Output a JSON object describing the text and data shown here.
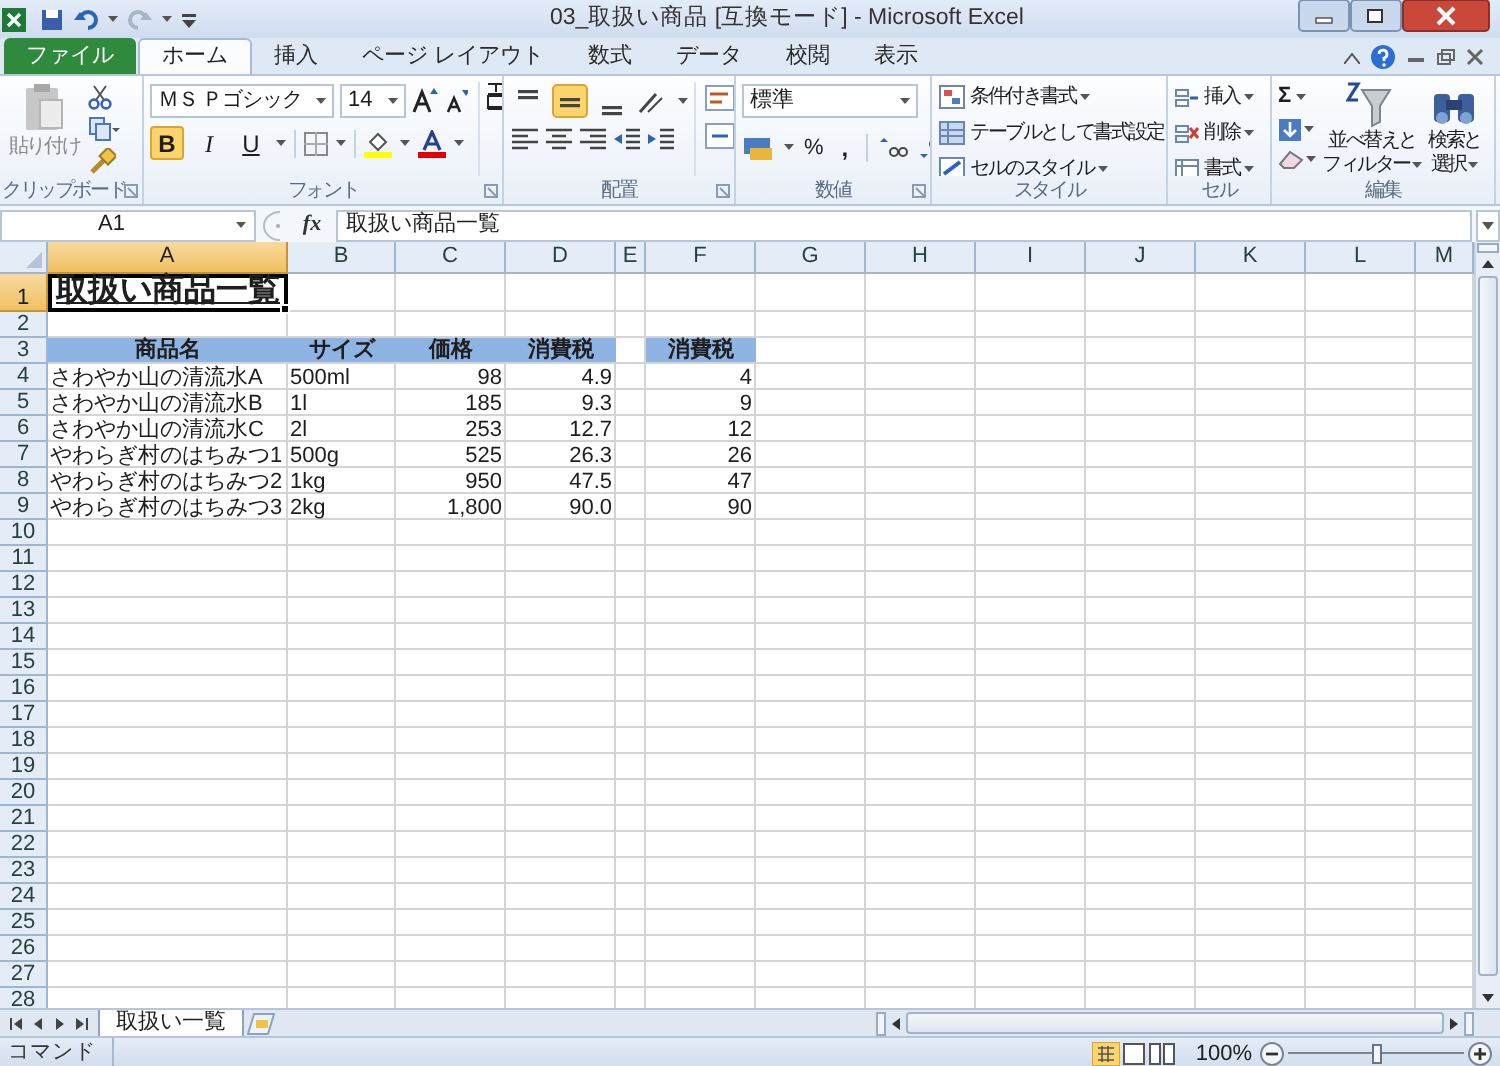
{
  "window": {
    "title": "03_取扱い商品 [互換モード] - Microsoft Excel"
  },
  "ribbon_tabs": [
    {
      "label": "ファイル",
      "kind": "file",
      "selected": false
    },
    {
      "label": "ホーム",
      "kind": "tab",
      "selected": true
    },
    {
      "label": "挿入",
      "kind": "tab",
      "selected": false
    },
    {
      "label": "ページ レイアウト",
      "kind": "tab",
      "selected": false
    },
    {
      "label": "数式",
      "kind": "tab",
      "selected": false
    },
    {
      "label": "データ",
      "kind": "tab",
      "selected": false
    },
    {
      "label": "校閲",
      "kind": "tab",
      "selected": false
    },
    {
      "label": "表示",
      "kind": "tab",
      "selected": false
    }
  ],
  "clipboard": {
    "paste": "貼り付け",
    "label": "クリップボード"
  },
  "font": {
    "name": "ＭＳ Ｐゴシック",
    "size": "14",
    "label": "フォント",
    "styles": [
      {
        "kind": "bold",
        "label": "B",
        "on": true
      },
      {
        "kind": "italic",
        "label": "I",
        "on": false
      },
      {
        "kind": "underline",
        "label": "U",
        "on": false
      }
    ]
  },
  "alignment": {
    "label": "配置",
    "middle_align_on": true
  },
  "number": {
    "format": "標準",
    "percent": "%",
    "comma": ",",
    "label": "数値"
  },
  "styles": {
    "items": [
      "条件付き書式",
      "テーブルとして書式設定",
      "セルのスタイル"
    ],
    "label": "スタイル"
  },
  "cells_group": {
    "items": [
      "挿入",
      "削除",
      "書式"
    ],
    "label": "セル"
  },
  "editing": {
    "sum": "Σ",
    "sort": [
      "並べ替えと",
      "フィルター"
    ],
    "find": [
      "検索と",
      "選択"
    ],
    "label": "編集"
  },
  "formula_bar": {
    "name_box": "A1",
    "fx": "fx",
    "value": "取扱い商品一覧"
  },
  "columns": [
    {
      "label": "A",
      "selected": true
    },
    {
      "label": "B",
      "selected": false
    },
    {
      "label": "C",
      "selected": false
    },
    {
      "label": "D",
      "selected": false
    },
    {
      "label": "E",
      "selected": false
    },
    {
      "label": "F",
      "selected": false
    },
    {
      "label": "G",
      "selected": false
    },
    {
      "label": "H",
      "selected": false
    },
    {
      "label": "I",
      "selected": false
    },
    {
      "label": "J",
      "selected": false
    },
    {
      "label": "K",
      "selected": false
    },
    {
      "label": "L",
      "selected": false
    },
    {
      "label": "M",
      "selected": false
    }
  ],
  "rows": [
    {
      "row": "1",
      "selected": true,
      "kind": "title",
      "title": "取扱い商品一覧"
    },
    {
      "row": "2",
      "selected": false
    },
    {
      "row": "3",
      "selected": false,
      "kind": "header",
      "name": "商品名",
      "size": "サイズ",
      "price": "価格",
      "tax": "消費税",
      "tax_rounded": "消費税"
    },
    {
      "row": "4",
      "selected": false,
      "kind": "item",
      "name": "さわやか山の清流水A",
      "size": "500ml",
      "price": "98",
      "tax": "4.9",
      "tax_rounded": "4"
    },
    {
      "row": "5",
      "selected": false,
      "kind": "item",
      "name": "さわやか山の清流水B",
      "size": "1l",
      "price": "185",
      "tax": "9.3",
      "tax_rounded": "9"
    },
    {
      "row": "6",
      "selected": false,
      "kind": "item",
      "name": "さわやか山の清流水C",
      "size": "2l",
      "price": "253",
      "tax": "12.7",
      "tax_rounded": "12"
    },
    {
      "row": "7",
      "selected": false,
      "kind": "item",
      "name": "やわらぎ村のはちみつ1",
      "size": "500g",
      "price": "525",
      "tax": "26.3",
      "tax_rounded": "26"
    },
    {
      "row": "8",
      "selected": false,
      "kind": "item",
      "name": "やわらぎ村のはちみつ2",
      "size": "1kg",
      "price": "950",
      "tax": "47.5",
      "tax_rounded": "47"
    },
    {
      "row": "9",
      "selected": false,
      "kind": "item",
      "name": "やわらぎ村のはちみつ3",
      "size": "2kg",
      "price": "1,800",
      "tax": "90.0",
      "tax_rounded": "90"
    },
    {
      "row": "10",
      "selected": false
    },
    {
      "row": "11",
      "selected": false
    },
    {
      "row": "12",
      "selected": false
    },
    {
      "row": "13",
      "selected": false
    },
    {
      "row": "14",
      "selected": false
    },
    {
      "row": "15",
      "selected": false
    },
    {
      "row": "16",
      "selected": false
    },
    {
      "row": "17",
      "selected": false
    },
    {
      "row": "18",
      "selected": false
    },
    {
      "row": "19",
      "selected": false
    },
    {
      "row": "20",
      "selected": false
    },
    {
      "row": "21",
      "selected": false
    },
    {
      "row": "22",
      "selected": false
    },
    {
      "row": "23",
      "selected": false
    },
    {
      "row": "24",
      "selected": false
    },
    {
      "row": "25",
      "selected": false
    },
    {
      "row": "26",
      "selected": false
    },
    {
      "row": "27",
      "selected": false
    },
    {
      "row": "28",
      "selected": false
    }
  ],
  "sheet_tabs": [
    {
      "label": "取扱い一覧",
      "selected": true
    }
  ],
  "status_bar": {
    "mode": "コマンド",
    "zoom": "100%",
    "zoom_slider": {
      "level": 0.5
    }
  }
}
